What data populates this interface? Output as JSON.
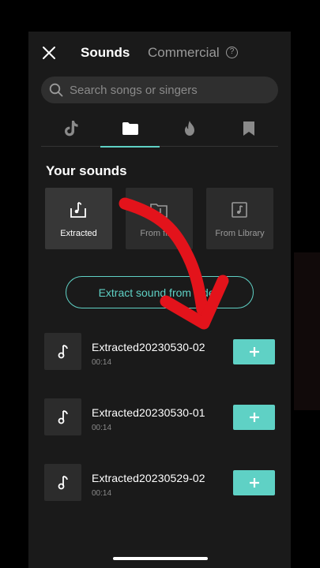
{
  "header": {
    "tab_sounds": "Sounds",
    "tab_commercial": "Commercial",
    "help": "?"
  },
  "search": {
    "placeholder": "Search songs or singers"
  },
  "category_tabs": [
    {
      "icon": "tiktok-icon",
      "active": false
    },
    {
      "icon": "folder-icon",
      "active": true
    },
    {
      "icon": "flame-icon",
      "active": false
    },
    {
      "icon": "bookmark-icon",
      "active": false
    }
  ],
  "your_sounds": {
    "title": "Your sounds",
    "tiles": [
      {
        "label": "Extracted",
        "icon": "extract-icon",
        "active": true
      },
      {
        "label": "From files",
        "icon": "folder-music-icon",
        "active": false
      },
      {
        "label": "From Library",
        "icon": "library-music-icon",
        "active": false
      }
    ]
  },
  "extract_button": {
    "label": "Extract sound from video"
  },
  "sounds": [
    {
      "name": "Extracted20230530-02",
      "duration": "00:14"
    },
    {
      "name": "Extracted20230530-01",
      "duration": "00:14"
    },
    {
      "name": "Extracted20230529-02",
      "duration": "00:14"
    }
  ],
  "add_label": "+",
  "colors": {
    "accent": "#5fd1c5",
    "arrow": "#e3131b",
    "background": "#1a1a1a",
    "tile": "#2c2c2c"
  }
}
